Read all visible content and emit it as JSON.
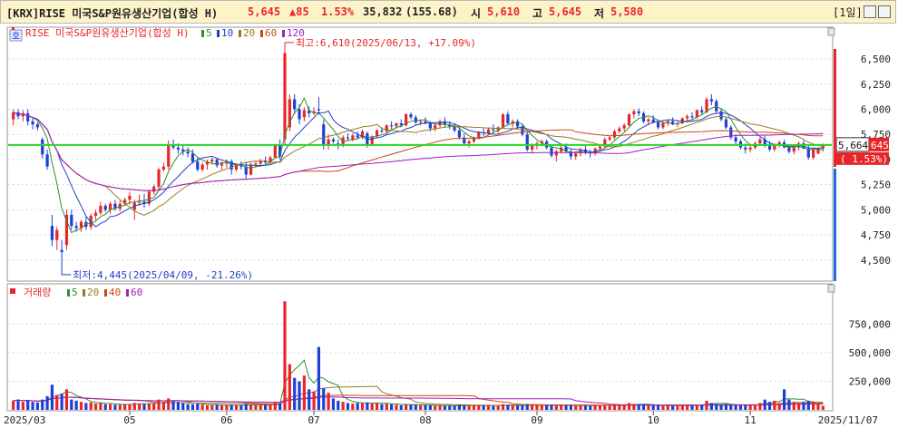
{
  "header": {
    "name": "[KRX]RISE 미국S&P원유생산기업(합성 H)",
    "price": "5,645",
    "change": "▲85",
    "change_pct": "1.53%",
    "volume": "35,832",
    "volume_pct": "(155.68)",
    "open_label": "시",
    "open": "5,610",
    "high_label": "고",
    "high": "5,645",
    "low_label": "저",
    "low": "5,580",
    "period": "[1일]",
    "colors": {
      "up": "#e8262a",
      "down": "#1f3fd8",
      "text": "#222222"
    }
  },
  "price_panel": {
    "legend": {
      "name": "RISE 미국S&P원유생산기업(합성 H)",
      "ma": [
        "5",
        "10",
        "20",
        "60",
        "120"
      ],
      "badge": "호"
    },
    "ma_colors": [
      "#2f8f2f",
      "#2040c8",
      "#9a7a20",
      "#c84a10",
      "#a020c0"
    ],
    "y_ticks": [
      "6,500",
      "6,250",
      "6,000",
      "5,750",
      "5,500",
      "5,250",
      "5,000",
      "4,750",
      "4,500"
    ],
    "current_label": "5,664",
    "current_label_suffix": "645",
    "current_change": "( 1.53%)",
    "high_annotation": "최고:6,610(2025/06/13, +17.09%)",
    "low_annotation": "최저:4,445(2025/04/09, -21.26%)"
  },
  "volume_panel": {
    "legend": {
      "name": "거래량",
      "ma": [
        "5",
        "20",
        "40",
        "60"
      ]
    },
    "y_ticks": [
      "750,000",
      "500,000",
      "250,000"
    ]
  },
  "x_axis": {
    "labels": [
      "2025/03",
      "05",
      "06",
      "07",
      "08",
      "09",
      "10",
      "11",
      "2025/11/07"
    ]
  },
  "chart_data": {
    "type": "candlestick",
    "title": "[KRX]RISE 미국S&P원유생산기업(합성 H)",
    "ylim_price": [
      4300,
      6780
    ],
    "ylim_volume": [
      0,
      1000000
    ],
    "candles": [
      [
        5900,
        6000,
        5840,
        5970,
        80000
      ],
      [
        5970,
        6000,
        5900,
        5930,
        90000
      ],
      [
        5930,
        5990,
        5880,
        5960,
        70000
      ],
      [
        5960,
        6000,
        5840,
        5880,
        85000
      ],
      [
        5880,
        5920,
        5800,
        5850,
        70000
      ],
      [
        5850,
        5870,
        5790,
        5820,
        65000
      ],
      [
        5700,
        5720,
        5510,
        5550,
        90000
      ],
      [
        5550,
        5600,
        5400,
        5430,
        120000
      ],
      [
        4840,
        4950,
        4640,
        4700,
        220000
      ],
      [
        4700,
        4830,
        4600,
        4800,
        130000
      ],
      [
        4600,
        4700,
        4445,
        4580,
        140000
      ],
      [
        4650,
        5000,
        4600,
        4950,
        180000
      ],
      [
        4950,
        5000,
        4800,
        4840,
        90000
      ],
      [
        4840,
        4880,
        4780,
        4820,
        80000
      ],
      [
        4820,
        4900,
        4780,
        4880,
        70000
      ],
      [
        4880,
        4930,
        4800,
        4830,
        60000
      ],
      [
        4830,
        4960,
        4800,
        4940,
        65000
      ],
      [
        4940,
        5000,
        4900,
        4970,
        55000
      ],
      [
        4970,
        5080,
        4950,
        5040,
        60000
      ],
      [
        5040,
        5060,
        4980,
        5000,
        50000
      ],
      [
        5000,
        5080,
        4960,
        5060,
        50000
      ],
      [
        5060,
        5100,
        4990,
        5010,
        45000
      ],
      [
        5010,
        5090,
        4980,
        5060,
        45000
      ],
      [
        5060,
        5120,
        5040,
        5100,
        50000
      ],
      [
        5100,
        5180,
        5050,
        5140,
        50000
      ],
      [
        5000,
        5100,
        4900,
        5070,
        60000
      ],
      [
        5070,
        5150,
        5040,
        5080,
        55000
      ],
      [
        5080,
        5160,
        5020,
        5060,
        50000
      ],
      [
        5060,
        5200,
        5040,
        5180,
        55000
      ],
      [
        5180,
        5250,
        5150,
        5230,
        60000
      ],
      [
        5230,
        5420,
        5200,
        5400,
        90000
      ],
      [
        5400,
        5470,
        5380,
        5430,
        70000
      ],
      [
        5430,
        5690,
        5400,
        5650,
        100000
      ],
      [
        5650,
        5700,
        5600,
        5620,
        80000
      ],
      [
        5620,
        5660,
        5560,
        5600,
        70000
      ],
      [
        5600,
        5640,
        5540,
        5580,
        60000
      ],
      [
        5580,
        5620,
        5520,
        5560,
        50000
      ],
      [
        5560,
        5600,
        5460,
        5480,
        50000
      ],
      [
        5480,
        5520,
        5380,
        5400,
        55000
      ],
      [
        5400,
        5470,
        5380,
        5450,
        45000
      ],
      [
        5450,
        5500,
        5400,
        5480,
        40000
      ],
      [
        5480,
        5520,
        5450,
        5500,
        40000
      ],
      [
        5500,
        5520,
        5420,
        5440,
        45000
      ],
      [
        5440,
        5480,
        5400,
        5460,
        40000
      ],
      [
        5460,
        5500,
        5420,
        5480,
        40000
      ],
      [
        5480,
        5500,
        5350,
        5400,
        45000
      ],
      [
        5400,
        5460,
        5380,
        5450,
        40000
      ],
      [
        5450,
        5480,
        5400,
        5430,
        40000
      ],
      [
        5430,
        5480,
        5300,
        5350,
        50000
      ],
      [
        5350,
        5470,
        5340,
        5450,
        45000
      ],
      [
        5450,
        5480,
        5420,
        5460,
        40000
      ],
      [
        5460,
        5510,
        5430,
        5490,
        40000
      ],
      [
        5490,
        5530,
        5450,
        5470,
        45000
      ],
      [
        5470,
        5540,
        5440,
        5520,
        45000
      ],
      [
        5520,
        5650,
        5510,
        5640,
        70000
      ],
      [
        5640,
        5700,
        5500,
        5530,
        60000
      ],
      [
        5700,
        6610,
        5650,
        6560,
        950000
      ],
      [
        5820,
        6150,
        5780,
        6100,
        400000
      ],
      [
        6100,
        6150,
        5950,
        6000,
        280000
      ],
      [
        6000,
        6050,
        5850,
        5900,
        250000
      ],
      [
        5920,
        6020,
        5880,
        5990,
        300000
      ],
      [
        5990,
        6030,
        5920,
        5960,
        180000
      ],
      [
        5960,
        6020,
        5940,
        5980,
        160000
      ],
      [
        6000,
        6120,
        5950,
        5990,
        550000
      ],
      [
        5850,
        5900,
        5600,
        5640,
        190000
      ],
      [
        5650,
        5750,
        5600,
        5700,
        150000
      ],
      [
        5700,
        5720,
        5660,
        5680,
        100000
      ],
      [
        5660,
        5700,
        5600,
        5640,
        80000
      ],
      [
        5640,
        5740,
        5620,
        5720,
        70000
      ],
      [
        5720,
        5760,
        5690,
        5710,
        60000
      ],
      [
        5700,
        5760,
        5680,
        5740,
        55000
      ],
      [
        5740,
        5780,
        5700,
        5720,
        60000
      ],
      [
        5720,
        5800,
        5700,
        5780,
        60000
      ],
      [
        5760,
        5780,
        5620,
        5650,
        65000
      ],
      [
        5650,
        5740,
        5640,
        5730,
        55000
      ],
      [
        5730,
        5800,
        5720,
        5790,
        60000
      ],
      [
        5790,
        5820,
        5760,
        5780,
        50000
      ],
      [
        5780,
        5850,
        5760,
        5840,
        55000
      ],
      [
        5840,
        5880,
        5800,
        5830,
        50000
      ],
      [
        5830,
        5870,
        5810,
        5860,
        45000
      ],
      [
        5860,
        5900,
        5820,
        5840,
        40000
      ],
      [
        5840,
        5960,
        5830,
        5950,
        50000
      ],
      [
        5950,
        5970,
        5900,
        5920,
        45000
      ],
      [
        5920,
        5940,
        5850,
        5870,
        45000
      ],
      [
        5870,
        5900,
        5840,
        5880,
        40000
      ],
      [
        5880,
        5920,
        5850,
        5860,
        40000
      ],
      [
        5860,
        5880,
        5780,
        5810,
        40000
      ],
      [
        5810,
        5860,
        5780,
        5840,
        35000
      ],
      [
        5840,
        5900,
        5820,
        5880,
        40000
      ],
      [
        5880,
        5920,
        5820,
        5850,
        35000
      ],
      [
        5850,
        5880,
        5800,
        5830,
        35000
      ],
      [
        5830,
        5860,
        5770,
        5790,
        35000
      ],
      [
        5790,
        5830,
        5700,
        5720,
        45000
      ],
      [
        5720,
        5760,
        5640,
        5660,
        40000
      ],
      [
        5660,
        5700,
        5620,
        5680,
        35000
      ],
      [
        5680,
        5730,
        5660,
        5720,
        40000
      ],
      [
        5720,
        5780,
        5700,
        5770,
        40000
      ],
      [
        5770,
        5810,
        5730,
        5760,
        40000
      ],
      [
        5760,
        5820,
        5740,
        5800,
        40000
      ],
      [
        5800,
        5850,
        5770,
        5790,
        35000
      ],
      [
        5790,
        5830,
        5760,
        5820,
        35000
      ],
      [
        5820,
        5960,
        5810,
        5950,
        50000
      ],
      [
        5950,
        5980,
        5840,
        5860,
        45000
      ],
      [
        5860,
        5900,
        5820,
        5880,
        40000
      ],
      [
        5880,
        5900,
        5800,
        5830,
        40000
      ],
      [
        5830,
        5850,
        5730,
        5750,
        40000
      ],
      [
        5750,
        5780,
        5580,
        5600,
        50000
      ],
      [
        5600,
        5660,
        5560,
        5640,
        45000
      ],
      [
        5640,
        5680,
        5600,
        5660,
        40000
      ],
      [
        5660,
        5700,
        5630,
        5680,
        40000
      ],
      [
        5680,
        5700,
        5600,
        5620,
        40000
      ],
      [
        5620,
        5650,
        5520,
        5540,
        45000
      ],
      [
        5540,
        5600,
        5480,
        5580,
        40000
      ],
      [
        5580,
        5640,
        5560,
        5620,
        40000
      ],
      [
        5620,
        5660,
        5560,
        5580,
        40000
      ],
      [
        5580,
        5600,
        5500,
        5530,
        40000
      ],
      [
        5530,
        5580,
        5500,
        5560,
        35000
      ],
      [
        5560,
        5620,
        5530,
        5600,
        40000
      ],
      [
        5600,
        5640,
        5550,
        5570,
        40000
      ],
      [
        5570,
        5600,
        5520,
        5560,
        35000
      ],
      [
        5560,
        5620,
        5540,
        5610,
        40000
      ],
      [
        5610,
        5650,
        5580,
        5630,
        40000
      ],
      [
        5630,
        5720,
        5620,
        5700,
        45000
      ],
      [
        5700,
        5740,
        5680,
        5720,
        40000
      ],
      [
        5720,
        5800,
        5700,
        5780,
        45000
      ],
      [
        5780,
        5830,
        5760,
        5810,
        40000
      ],
      [
        5810,
        5860,
        5780,
        5840,
        40000
      ],
      [
        5840,
        5960,
        5830,
        5950,
        60000
      ],
      [
        5950,
        6000,
        5910,
        5980,
        50000
      ],
      [
        5980,
        6010,
        5930,
        5960,
        50000
      ],
      [
        5960,
        5980,
        5860,
        5880,
        45000
      ],
      [
        5880,
        5920,
        5840,
        5900,
        40000
      ],
      [
        5900,
        5940,
        5860,
        5870,
        40000
      ],
      [
        5870,
        5900,
        5800,
        5820,
        40000
      ],
      [
        5820,
        5880,
        5800,
        5860,
        35000
      ],
      [
        5860,
        5900,
        5830,
        5880,
        40000
      ],
      [
        5880,
        5920,
        5840,
        5850,
        35000
      ],
      [
        5850,
        5890,
        5820,
        5860,
        35000
      ],
      [
        5860,
        5920,
        5850,
        5910,
        40000
      ],
      [
        5910,
        5950,
        5880,
        5930,
        40000
      ],
      [
        5930,
        5970,
        5900,
        5920,
        40000
      ],
      [
        5920,
        6000,
        5910,
        5990,
        45000
      ],
      [
        5990,
        6030,
        5950,
        5970,
        45000
      ],
      [
        5970,
        6120,
        5960,
        6100,
        80000
      ],
      [
        6100,
        6150,
        6040,
        6080,
        60000
      ],
      [
        6080,
        6100,
        5960,
        5980,
        50000
      ],
      [
        5980,
        6000,
        5880,
        5900,
        45000
      ],
      [
        5900,
        5920,
        5800,
        5820,
        50000
      ],
      [
        5820,
        5840,
        5700,
        5720,
        45000
      ],
      [
        5720,
        5750,
        5650,
        5680,
        40000
      ],
      [
        5680,
        5700,
        5600,
        5620,
        40000
      ],
      [
        5620,
        5660,
        5560,
        5600,
        45000
      ],
      [
        5600,
        5640,
        5570,
        5620,
        40000
      ],
      [
        5620,
        5680,
        5600,
        5660,
        45000
      ],
      [
        5660,
        5720,
        5640,
        5700,
        60000
      ],
      [
        5700,
        5740,
        5620,
        5640,
        90000
      ],
      [
        5640,
        5680,
        5580,
        5600,
        70000
      ],
      [
        5600,
        5660,
        5580,
        5640,
        80000
      ],
      [
        5640,
        5690,
        5620,
        5670,
        60000
      ],
      [
        5670,
        5700,
        5610,
        5620,
        180000
      ],
      [
        5620,
        5650,
        5560,
        5580,
        90000
      ],
      [
        5580,
        5640,
        5550,
        5620,
        70000
      ],
      [
        5620,
        5680,
        5590,
        5660,
        60000
      ],
      [
        5660,
        5690,
        5600,
        5610,
        70000
      ],
      [
        5610,
        5650,
        5500,
        5520,
        80000
      ],
      [
        5520,
        5620,
        5500,
        5600,
        70000
      ],
      [
        5560,
        5620,
        5550,
        5610,
        50000
      ],
      [
        5610,
        5660,
        5580,
        5645,
        35832
      ]
    ],
    "ma": {
      "5": [
        5950,
        5940,
        5930,
        5910,
        5890,
        5860,
        5700,
        5550,
        5300,
        5050,
        4860,
        4780,
        4820,
        4860,
        4880,
        4870,
        4880,
        4910,
        4960,
        4980,
        5000,
        5020,
        5040,
        5060,
        5080,
        5080,
        5090,
        5090,
        5100,
        5120,
        5180,
        5260,
        5370,
        5470,
        5550,
        5580,
        5560,
        5530,
        5490,
        5470,
        5450,
        5450,
        5450,
        5460,
        5470,
        5450,
        5440,
        5430,
        5410,
        5420,
        5430,
        5450,
        5470,
        5490,
        5520,
        5560,
        5700,
        5860,
        5960,
        6010,
        6050,
        6000,
        5970,
        5960,
        5900,
        5850,
        5800,
        5740,
        5690,
        5700,
        5710,
        5720,
        5730,
        5730,
        5730,
        5740,
        5760,
        5790,
        5810,
        5830,
        5850,
        5860,
        5870,
        5870,
        5860,
        5850,
        5840,
        5840,
        5840,
        5830,
        5820,
        5780,
        5740,
        5720,
        5710,
        5710,
        5730,
        5750,
        5780,
        5810,
        5840,
        5850,
        5850,
        5840,
        5780,
        5710,
        5670,
        5650,
        5640,
        5610,
        5590,
        5580,
        5570,
        5560,
        5560,
        5570,
        5570,
        5580,
        5590,
        5610,
        5640,
        5670,
        5720,
        5760,
        5800,
        5850,
        5890,
        5920,
        5930,
        5930,
        5910,
        5880,
        5860,
        5860,
        5860,
        5860,
        5870,
        5890,
        5900,
        5920,
        5950,
        5980,
        6000,
        6010,
        5990,
        5950,
        5880,
        5800,
        5730,
        5670,
        5640,
        5640,
        5640,
        5640,
        5640,
        5640,
        5640,
        5630,
        5620,
        5620,
        5610,
        5600,
        5600,
        5600,
        5610,
        5620
      ]
    },
    "annotations": {
      "high": {
        "value": 6610,
        "date": "2025/06/13",
        "pct": "+17.09%"
      },
      "low": {
        "value": 4445,
        "date": "2025/04/09",
        "pct": "-21.26%"
      }
    }
  }
}
